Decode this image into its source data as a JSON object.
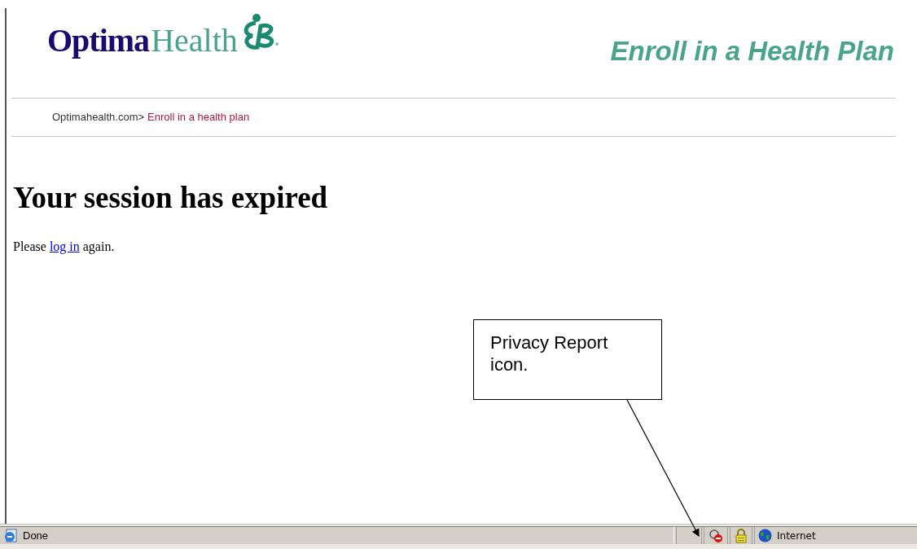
{
  "header": {
    "logo_part_1": "Optima",
    "logo_part_2": "Health",
    "tagline": "Enroll in a Health Plan"
  },
  "breadcrumb": {
    "root": "Optimahealth.com>",
    "current": "Enroll in a health plan"
  },
  "heading": "Your session has expired",
  "message": {
    "before": "Please",
    "link": "log in",
    "after": "again."
  },
  "callout": {
    "text": "Privacy Report icon."
  },
  "status_bar": {
    "status": "Done",
    "zone": "Internet"
  }
}
